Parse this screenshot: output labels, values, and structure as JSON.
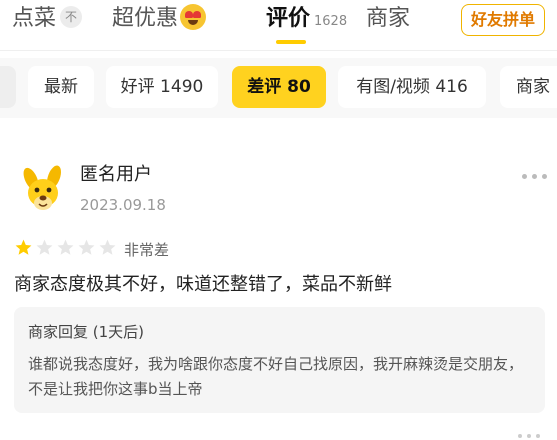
{
  "tabs": {
    "diancai": "点菜",
    "diancai_badge": "不",
    "chaoyouhui": "超优惠",
    "pingjia": "评价",
    "pingjia_count": "1628",
    "shangjia": "商家"
  },
  "friend_button": "好友拼单",
  "filters": [
    {
      "label": "最新",
      "active": false
    },
    {
      "label": "好评 1490",
      "active": false
    },
    {
      "label": "差评 80",
      "active": true
    },
    {
      "label": "有图/视频 416",
      "active": false
    },
    {
      "label": "商家",
      "active": false
    }
  ],
  "review": {
    "username": "匿名用户",
    "date": "2023.09.18",
    "rating": 1,
    "rating_max": 5,
    "rating_text": "非常差",
    "text": "商家态度极其不好，味道还整错了，菜品不新鲜",
    "reply": {
      "title": "商家回复 (1天后)",
      "text": "谁都说我态度好，我为啥跟你态度不好自己找原因，我开麻辣烫是交朋友，不是让我把你这事b当上帝"
    }
  },
  "colors": {
    "accent": "#ffd21f",
    "star_filled": "#ffcc00",
    "star_empty": "#e6e6e6",
    "friend_button_border": "#f0b400",
    "friend_button_text": "#e07a00"
  },
  "icons": {
    "emoji": "heart-eyes-face-icon",
    "avatar": "yellow-dog-avatar",
    "more": "more-dots-icon"
  }
}
